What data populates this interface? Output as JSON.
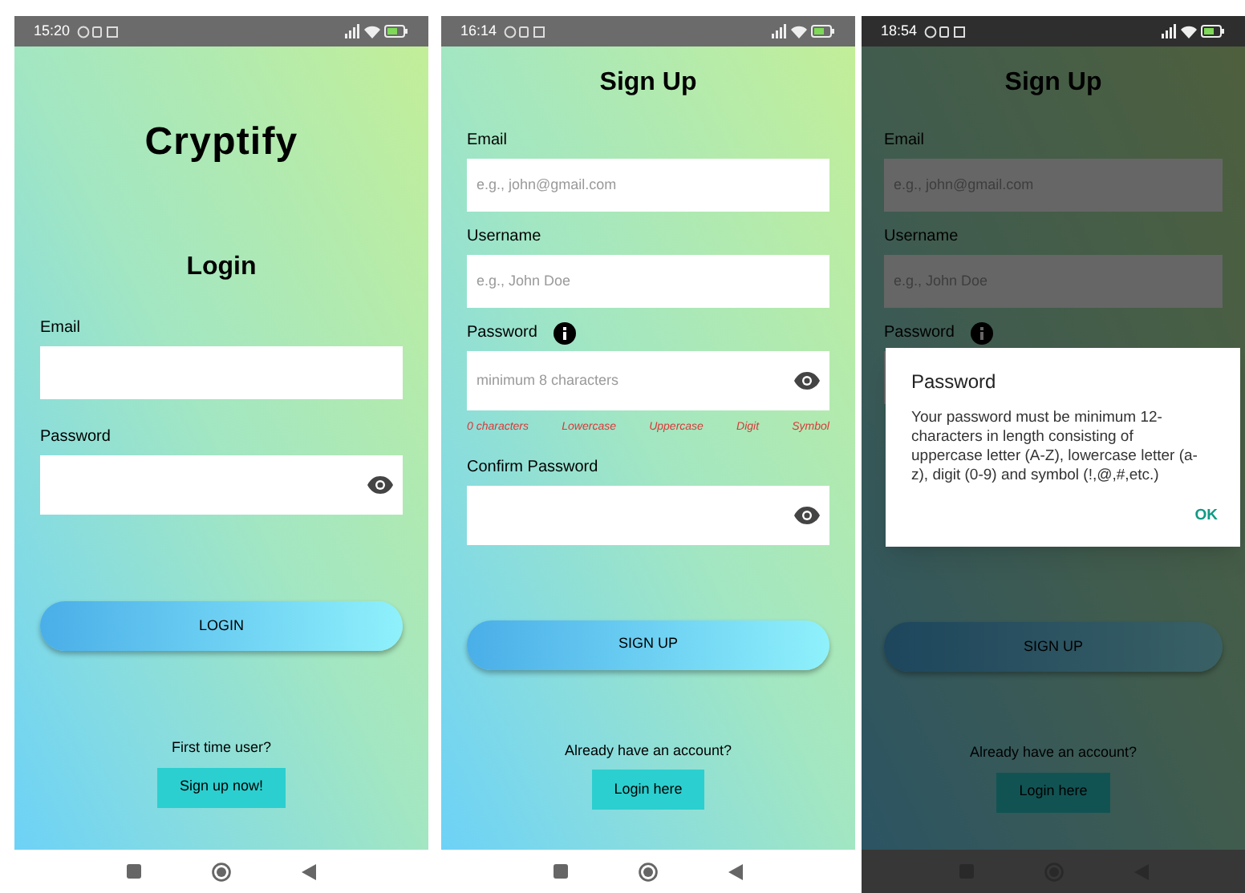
{
  "screens": [
    {
      "kind": "login",
      "status_time": "15:20",
      "app_title": "Cryptify",
      "heading": "Login",
      "dimmed": false,
      "fields": [
        {
          "label": "Email",
          "info": false,
          "reveal": false
        },
        {
          "label": "Password",
          "info": false,
          "reveal": true
        }
      ],
      "primary_button": "LOGIN",
      "footer_prompt": "First time user?",
      "footer_button": "Sign up now!"
    },
    {
      "kind": "signup",
      "status_time": "16:14",
      "heading": "Sign Up",
      "dimmed": false,
      "fields": [
        {
          "label": "Email",
          "placeholder": "e.g., john@gmail.com",
          "info": false,
          "reveal": false
        },
        {
          "label": "Username",
          "placeholder": "e.g., John Doe",
          "info": false,
          "reveal": false
        },
        {
          "label": "Password",
          "placeholder": "minimum 8 characters",
          "info": true,
          "reveal": true,
          "hints": [
            "0 characters",
            "Lowercase",
            "Uppercase",
            "Digit",
            "Symbol"
          ]
        },
        {
          "label": "Confirm Password",
          "info": false,
          "reveal": true
        }
      ],
      "primary_button": "SIGN UP",
      "footer_prompt": "Already have an account?",
      "footer_button": "Login here"
    },
    {
      "kind": "signup",
      "status_time": "18:54",
      "heading": "Sign Up",
      "dimmed": true,
      "fields": [
        {
          "label": "Email",
          "placeholder": "e.g., john@gmail.com",
          "info": false,
          "reveal": false
        },
        {
          "label": "Username",
          "placeholder": "e.g., John Doe",
          "info": false,
          "reveal": false
        },
        {
          "label": "Password",
          "info": true,
          "reveal": false
        }
      ],
      "primary_button": "SIGN UP",
      "footer_prompt": "Already have an account?",
      "footer_button": "Login here",
      "dialog": {
        "title": "Password",
        "message": "Your password must be minimum 12-characters in length consisting of uppercase letter (A-Z), lowercase letter (a-z), digit (0-9) and symbol (!,@,#,etc.)",
        "button": "OK"
      }
    }
  ]
}
